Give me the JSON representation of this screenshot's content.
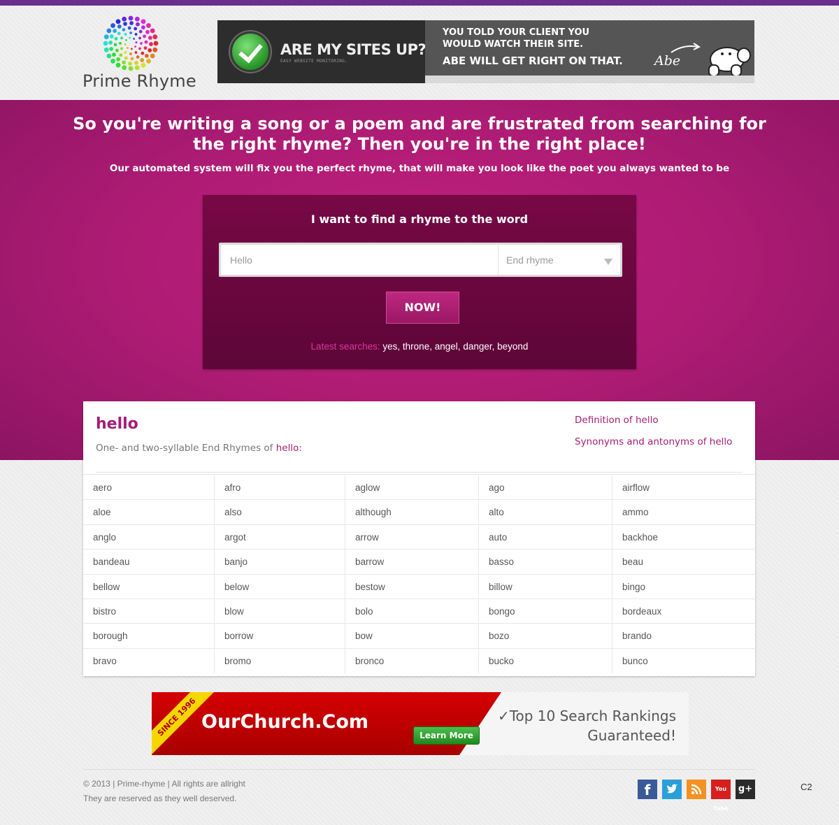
{
  "brand": {
    "name": "Prime Rhyme"
  },
  "top_ad": {
    "title": "ARE MY SITES UP?",
    "subtitle": "EASY WEBSITE MONITORING.",
    "line1": "YOU TOLD YOUR CLIENT YOU",
    "line2": "WOULD WATCH THEIR SITE.",
    "line3": "ABE WILL GET RIGHT ON THAT.",
    "signature": "Abe"
  },
  "hero": {
    "title": "So you're writing a song or a poem and are frustrated from searching for the right rhyme? Then you're in the right place!",
    "subtitle": "Our automated system will fix you the perfect rhyme, that will make you look like the poet you always wanted to be"
  },
  "search": {
    "heading": "I want to find a rhyme to the word",
    "placeholder": "Hello",
    "rhyme_type": "End rhyme",
    "button": "NOW!",
    "latest_label": "Latest searches:",
    "latest": [
      "yes",
      "throne",
      "angel",
      "danger",
      "beyond"
    ]
  },
  "results": {
    "word": "hello",
    "desc_prefix": "One- and two-syllable End Rhymes of",
    "desc_word": "hello",
    "desc_suffix": ":",
    "links": [
      "Definition of hello",
      "Synonyms and antonyms of hello"
    ],
    "rows": [
      [
        "aero",
        "afro",
        "aglow",
        "ago",
        "airflow"
      ],
      [
        "aloe",
        "also",
        "although",
        "alto",
        "ammo"
      ],
      [
        "anglo",
        "argot",
        "arrow",
        "auto",
        "backhoe"
      ],
      [
        "bandeau",
        "banjo",
        "barrow",
        "basso",
        "beau"
      ],
      [
        "bellow",
        "below",
        "bestow",
        "billow",
        "bingo"
      ],
      [
        "bistro",
        "blow",
        "bolo",
        "bongo",
        "bordeaux"
      ],
      [
        "borough",
        "borrow",
        "bow",
        "bozo",
        "brando"
      ],
      [
        "bravo",
        "bromo",
        "bronco",
        "bucko",
        "bunco"
      ]
    ]
  },
  "bottom_ad": {
    "since": "SINCE 1996",
    "name": "OurChurch.Com",
    "button": "Learn More",
    "claim_line1": "✓Top 10 Search Rankings",
    "claim_line2": "Guaranteed!"
  },
  "footer": {
    "copyright": "© 2013 | Prime-rhyme | All rights are allright",
    "tagline": "They are reserved as they well deserved.",
    "social": [
      "facebook-icon",
      "twitter-icon",
      "rss-icon",
      "youtube-icon",
      "google-plus-icon"
    ],
    "social_glyphs": {
      "facebook": "f",
      "youtube": "You Tube",
      "google_plus": "g+"
    },
    "page_code": "C2"
  },
  "colors": {
    "accent": "#a41d74",
    "hero_bg": "#b51c78",
    "search_box": "#6a0740",
    "top_stripe": "#6b2e8c"
  }
}
